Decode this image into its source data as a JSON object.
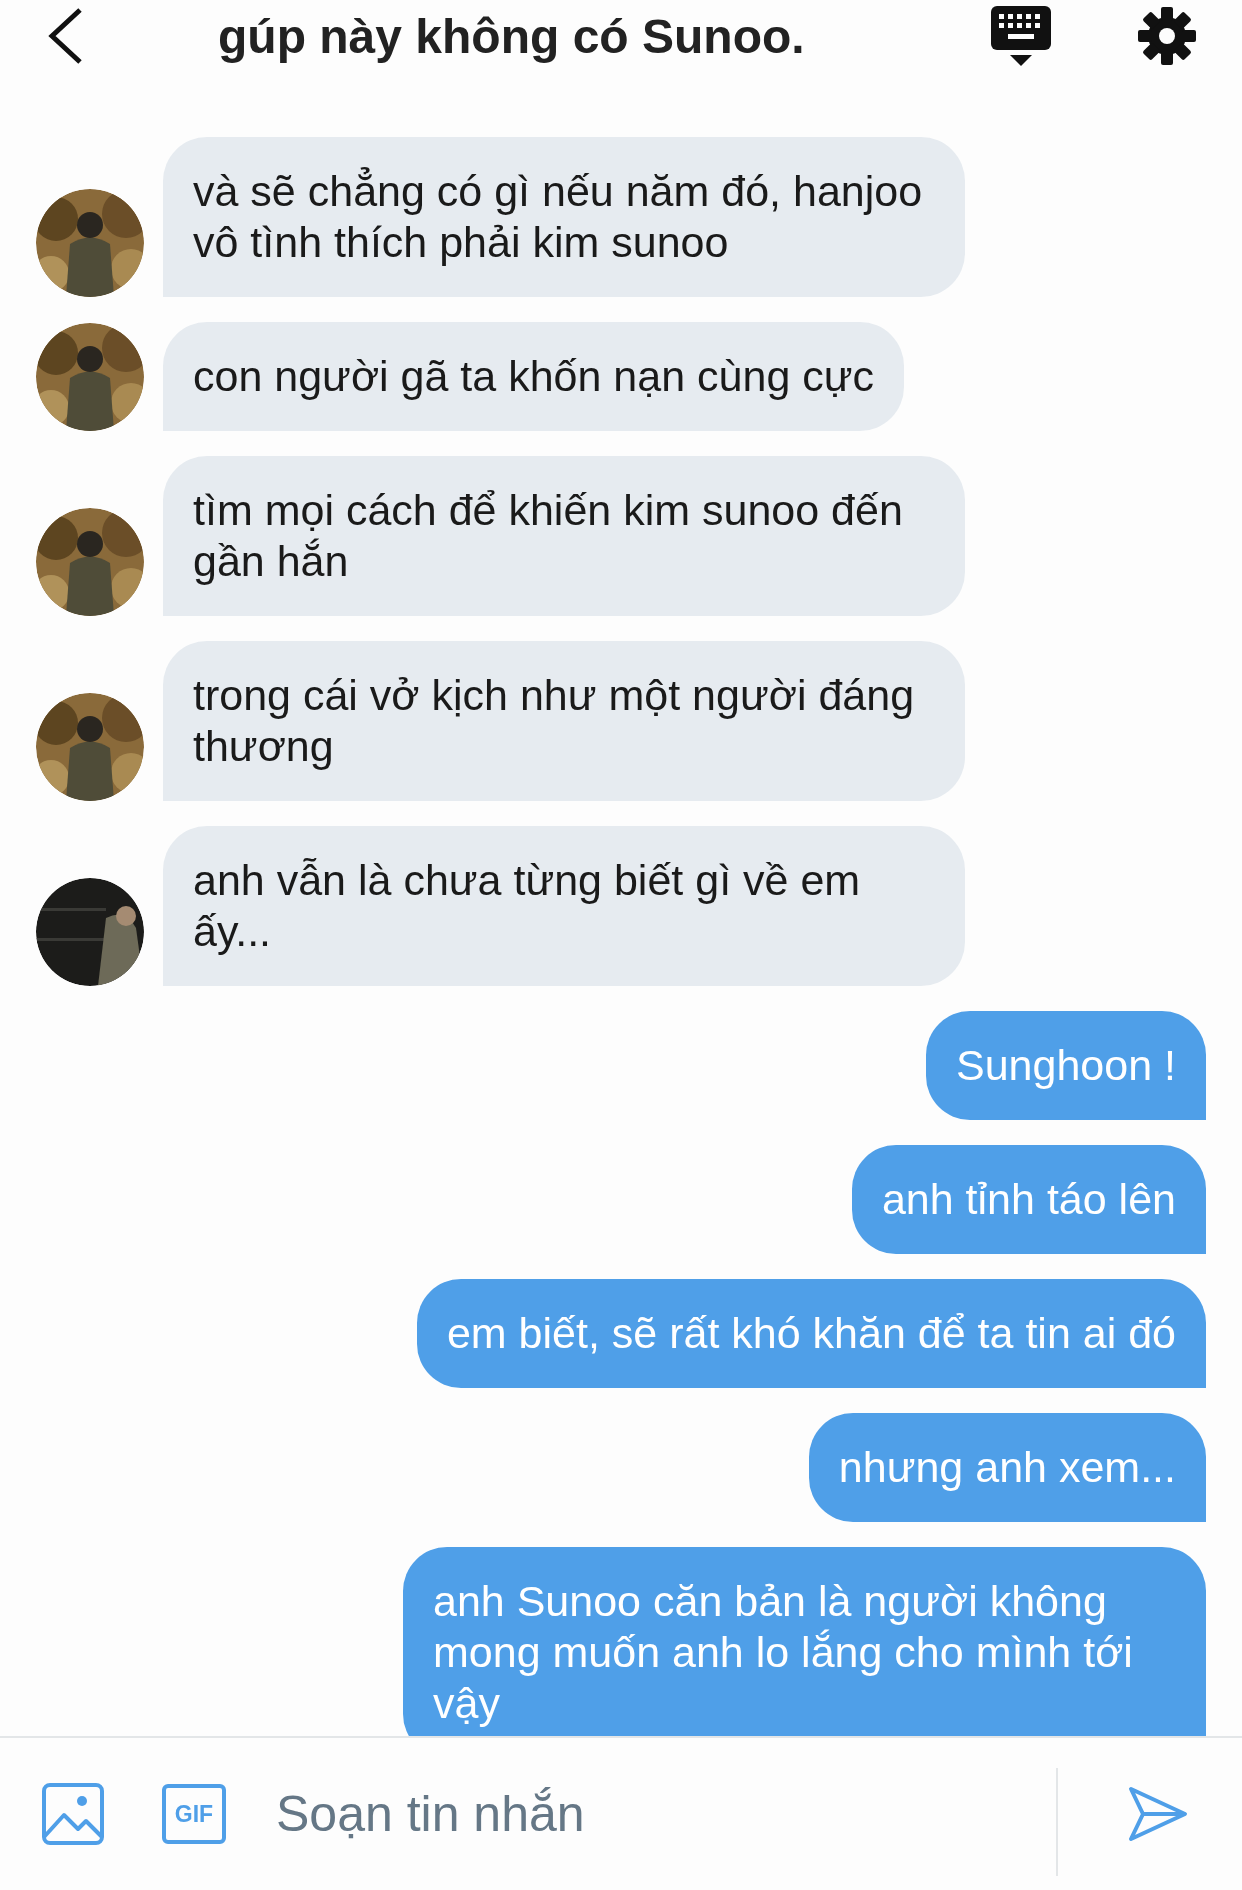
{
  "header": {
    "title": "gúp này không có Sunoo."
  },
  "messages": [
    {
      "kind": "incoming",
      "text": "và sẽ chẳng có gì nếu năm đó, hanjoo vô tình thích phải kim sunoo"
    },
    {
      "kind": "incoming",
      "text": "con người gã ta khốn nạn cùng cực"
    },
    {
      "kind": "incoming",
      "text": "tìm mọi cách để khiến kim sunoo đến gần hắn"
    },
    {
      "kind": "incoming",
      "text": "trong cái vở kịch như một người đáng thương"
    },
    {
      "kind": "incoming",
      "text": "anh vẫn là chưa từng biết gì về em ấy..."
    },
    {
      "kind": "outgoing",
      "text": "Sunghoon !"
    },
    {
      "kind": "outgoing",
      "text": "anh tỉnh táo lên"
    },
    {
      "kind": "outgoing",
      "text": "em biết, sẽ rất khó khăn để ta tin ai đó"
    },
    {
      "kind": "outgoing",
      "text": "nhưng anh xem..."
    },
    {
      "kind": "outgoing",
      "text": "anh Sunoo căn bản là người không mong muốn anh lo lắng cho mình tới vậy"
    }
  ],
  "composer": {
    "gif_label": "GIF",
    "placeholder": "Soạn tin nhắn"
  }
}
